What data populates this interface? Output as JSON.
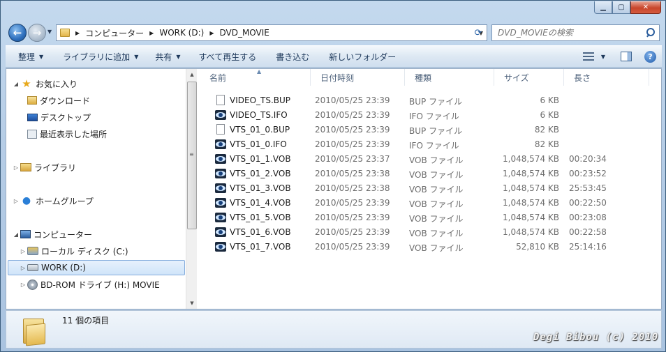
{
  "window": {
    "caption": {
      "minimize": "▁",
      "maximize": "▢",
      "close": "✕"
    }
  },
  "address": {
    "crumbs": [
      "コンピューター",
      "WORK (D:)",
      "DVD_MOVIE"
    ]
  },
  "search": {
    "placeholder": "DVD_MOVIEの検索"
  },
  "toolbar": {
    "organize": "整理",
    "add_to_library": "ライブラリに追加",
    "share": "共有",
    "play_all": "すべて再生する",
    "burn": "書き込む",
    "new_folder": "新しいフォルダー",
    "help": "?"
  },
  "nav": {
    "favorites": "お気に入り",
    "downloads": "ダウンロード",
    "desktop": "デスクトップ",
    "recent": "最近表示した場所",
    "libraries": "ライブラリ",
    "homegroup": "ホームグループ",
    "computer": "コンピューター",
    "local_disk": "ローカル ディスク (C:)",
    "work": "WORK (D:)",
    "bdrom": "BD-ROM ドライブ (H:) MOVIE"
  },
  "columns": {
    "name": "名前",
    "date": "日付時刻",
    "type": "種類",
    "size": "サイズ",
    "length": "長さ"
  },
  "files": [
    {
      "name": "VIDEO_TS.BUP",
      "date": "2010/05/25 23:39",
      "type": "BUP ファイル",
      "size": "6 KB",
      "length": "",
      "icon": "blank-file-icon"
    },
    {
      "name": "VIDEO_TS.IFO",
      "date": "2010/05/25 23:39",
      "type": "IFO ファイル",
      "size": "6 KB",
      "length": "",
      "icon": "media-file-icon"
    },
    {
      "name": "VTS_01_0.BUP",
      "date": "2010/05/25 23:39",
      "type": "BUP ファイル",
      "size": "82 KB",
      "length": "",
      "icon": "blank-file-icon"
    },
    {
      "name": "VTS_01_0.IFO",
      "date": "2010/05/25 23:39",
      "type": "IFO ファイル",
      "size": "82 KB",
      "length": "",
      "icon": "media-file-icon"
    },
    {
      "name": "VTS_01_1.VOB",
      "date": "2010/05/25 23:37",
      "type": "VOB ファイル",
      "size": "1,048,574 KB",
      "length": "00:20:34",
      "icon": "media-file-icon"
    },
    {
      "name": "VTS_01_2.VOB",
      "date": "2010/05/25 23:38",
      "type": "VOB ファイル",
      "size": "1,048,574 KB",
      "length": "00:23:52",
      "icon": "media-file-icon"
    },
    {
      "name": "VTS_01_3.VOB",
      "date": "2010/05/25 23:38",
      "type": "VOB ファイル",
      "size": "1,048,574 KB",
      "length": "25:53:45",
      "icon": "media-file-icon"
    },
    {
      "name": "VTS_01_4.VOB",
      "date": "2010/05/25 23:39",
      "type": "VOB ファイル",
      "size": "1,048,574 KB",
      "length": "00:22:50",
      "icon": "media-file-icon"
    },
    {
      "name": "VTS_01_5.VOB",
      "date": "2010/05/25 23:39",
      "type": "VOB ファイル",
      "size": "1,048,574 KB",
      "length": "00:23:08",
      "icon": "media-file-icon"
    },
    {
      "name": "VTS_01_6.VOB",
      "date": "2010/05/25 23:39",
      "type": "VOB ファイル",
      "size": "1,048,574 KB",
      "length": "00:22:58",
      "icon": "media-file-icon"
    },
    {
      "name": "VTS_01_7.VOB",
      "date": "2010/05/25 23:39",
      "type": "VOB ファイル",
      "size": "52,810 KB",
      "length": "25:14:16",
      "icon": "media-file-icon"
    }
  ],
  "details": {
    "item_count": "11 個の項目"
  },
  "watermark": "Degi Bibou (c) 2010"
}
